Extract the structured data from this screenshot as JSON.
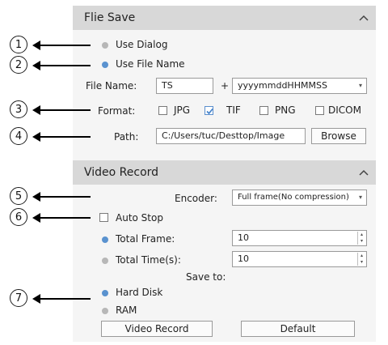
{
  "file_save": {
    "title": "Flie Save",
    "use_dialog": "Use Dialog",
    "use_file_name": "Use File Name",
    "file_name_label": "File Name:",
    "file_name_value": "TS",
    "plus": "+",
    "date_format": "yyyymmddHHMMSS",
    "format_label": "Format:",
    "formats": [
      "JPG",
      "TIF",
      "PNG",
      "DICOM"
    ],
    "path_label": "Path:",
    "path_value": "C:/Users/tuc/Desttop/Image",
    "browse": "Browse"
  },
  "video_record": {
    "title": "Video Record",
    "encoder_label": "Encoder:",
    "encoder_value": "Full frame(No compression)",
    "auto_stop": "Auto Stop",
    "total_frame_label": "Total Frame:",
    "total_frame_value": "10",
    "total_time_label": "Total Time(s):",
    "total_time_value": "10",
    "save_to": "Save to:",
    "hard_disk": "Hard Disk",
    "ram": "RAM",
    "video_record_button": "Video Record",
    "default_button": "Default"
  },
  "annotations": [
    "1",
    "2",
    "3",
    "4",
    "5",
    "6",
    "7"
  ],
  "colors": {
    "accent": "#5a92cf",
    "header": "#d8d8d8",
    "panel": "#f5f5f5"
  }
}
